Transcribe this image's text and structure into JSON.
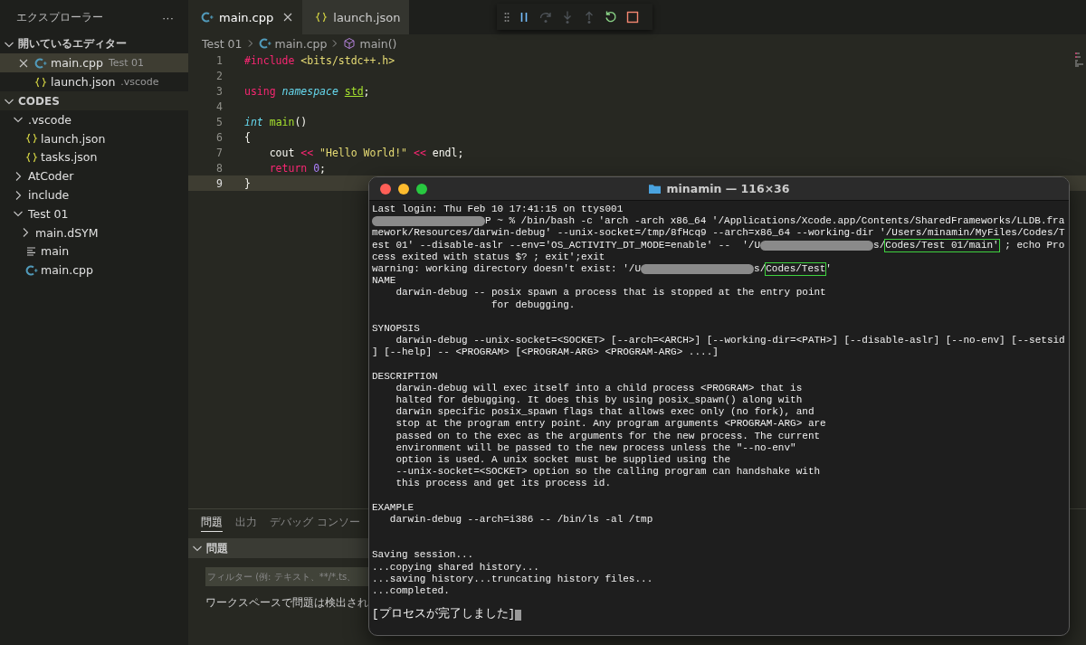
{
  "sidebar": {
    "title": "エクスプローラー",
    "more": "···",
    "open_editors": {
      "title": "開いているエディター",
      "expanded": true,
      "items": [
        {
          "name": "main.cpp",
          "description": "Test 01",
          "kind": "cpp",
          "selected": true
        },
        {
          "name": "launch.json",
          "description": ".vscode",
          "kind": "json",
          "selected": false
        }
      ]
    },
    "folder": {
      "title": "CODES",
      "expanded": true,
      "items": [
        {
          "name": ".vscode",
          "kind": "folder",
          "expanded": true,
          "children": [
            {
              "name": "launch.json",
              "kind": "json"
            },
            {
              "name": "tasks.json",
              "kind": "json"
            }
          ]
        },
        {
          "name": "AtCoder",
          "kind": "folder",
          "expanded": false
        },
        {
          "name": "include",
          "kind": "folder",
          "expanded": false
        },
        {
          "name": "Test 01",
          "kind": "folder",
          "expanded": true,
          "children": [
            {
              "name": "main.dSYM",
              "kind": "folder",
              "expanded": false
            },
            {
              "name": "main",
              "kind": "binary"
            },
            {
              "name": "main.cpp",
              "kind": "cpp"
            }
          ]
        }
      ]
    }
  },
  "tabs": [
    {
      "label": "main.cpp",
      "kind": "cpp",
      "selected": true
    },
    {
      "label": "launch.json",
      "kind": "json",
      "selected": false
    }
  ],
  "debug_toolbar": [
    {
      "kind": "grip",
      "disabled": false
    },
    {
      "kind": "pause",
      "disabled": false
    },
    {
      "kind": "step-over",
      "disabled": true
    },
    {
      "kind": "step-into",
      "disabled": true
    },
    {
      "kind": "step-out",
      "disabled": true
    },
    {
      "kind": "restart",
      "disabled": false
    },
    {
      "kind": "stop",
      "disabled": false
    }
  ],
  "breadcrumb": [
    {
      "label": "Test 01",
      "kind": "folder"
    },
    {
      "label": "main.cpp",
      "kind": "cpp"
    },
    {
      "label": "main()",
      "kind": "symbol"
    }
  ],
  "code": [
    {
      "number": "1",
      "current": false,
      "tokens": [
        {
          "kind": "keyword",
          "text": "#include "
        },
        {
          "kind": "string",
          "text": "<bits/stdc++.h>"
        }
      ]
    },
    {
      "number": "2",
      "current": false
    },
    {
      "number": "3",
      "current": false,
      "tokens": [
        {
          "kind": "keyword",
          "text": "using "
        },
        {
          "kind": "type",
          "text": "namespace "
        },
        {
          "kind": "name",
          "text": "std"
        },
        {
          "kind": "plain",
          "text": ";"
        }
      ]
    },
    {
      "number": "4",
      "current": false
    },
    {
      "number": "5",
      "current": false,
      "tokens": [
        {
          "kind": "type",
          "text": "int "
        },
        {
          "kind": "func",
          "text": "main"
        },
        {
          "kind": "plain",
          "text": "()"
        }
      ]
    },
    {
      "number": "6",
      "current": false,
      "tokens": [
        {
          "kind": "plain",
          "text": "{"
        }
      ]
    },
    {
      "number": "7",
      "current": false,
      "tokens": [
        {
          "kind": "plain",
          "text": "    cout "
        },
        {
          "kind": "keyword",
          "text": "<< "
        },
        {
          "kind": "string",
          "text": "\"Hello World!\" "
        },
        {
          "kind": "keyword",
          "text": "<< "
        },
        {
          "kind": "plain",
          "text": "endl;"
        }
      ]
    },
    {
      "number": "8",
      "current": false,
      "tokens": [
        {
          "kind": "keyword",
          "text": "    return "
        },
        {
          "kind": "number",
          "text": "0"
        },
        {
          "kind": "plain",
          "text": ";"
        }
      ]
    },
    {
      "number": "9",
      "current": true,
      "tokens": [
        {
          "kind": "plain",
          "text": "}"
        }
      ]
    }
  ],
  "panel": {
    "tabs": [
      {
        "label": "問題",
        "selected": true
      },
      {
        "label": "出力",
        "selected": false
      },
      {
        "label": "デバッグ コンソー",
        "selected": false
      }
    ],
    "section": "問題",
    "filter": {
      "placeholder": "フィルター (例: テキスト、**/*.ts、"
    },
    "message": "ワークスペースで問題は検出され"
  },
  "terminal": {
    "title": "minamin — 116×36",
    "lines": [
      {
        "kind": "text",
        "segments": [
          {
            "kind": "text",
            "text": "Last login: Thu Feb 10 17:41:15 on ttys001"
          }
        ]
      },
      {
        "kind": "text",
        "segments": [
          {
            "kind": "redacted"
          },
          {
            "kind": "text",
            "text": "P ~ % /bin/bash -c 'arch -arch x86_64 '/Applications/Xcode.app/Contents/SharedFrameworks/LLDB.fra"
          }
        ]
      },
      {
        "kind": "text",
        "segments": [
          {
            "kind": "text",
            "text": "mework/Resources/darwin-debug' --unix-socket=/tmp/8fHcq9 --arch=x86_64 --working-dir '/Users/minamin/MyFiles/Codes/T"
          }
        ]
      },
      {
        "kind": "text",
        "segments": [
          {
            "kind": "text",
            "text": "est 01' --disable-aslr --env='OS_ACTIVITY_DT_MODE=enable' --  '/U"
          },
          {
            "kind": "redacted"
          },
          {
            "kind": "text",
            "text": "s/"
          },
          {
            "kind": "boxed",
            "text": "Codes/Test 01/main'"
          },
          {
            "kind": "text",
            "text": " ; echo Pro"
          }
        ]
      },
      {
        "kind": "text",
        "segments": [
          {
            "kind": "text",
            "text": "cess exited with status $? ; exit';exit"
          }
        ]
      },
      {
        "kind": "text",
        "segments": [
          {
            "kind": "text",
            "text": "warning: working directory doesn't exist: '/U"
          },
          {
            "kind": "redacted"
          },
          {
            "kind": "text",
            "text": "s/"
          },
          {
            "kind": "boxed",
            "text": "Codes/Test"
          },
          {
            "kind": "text",
            "text": "'"
          }
        ]
      },
      {
        "kind": "text",
        "segments": [
          {
            "kind": "text",
            "text": "NAME"
          }
        ]
      },
      {
        "kind": "text",
        "segments": [
          {
            "kind": "text",
            "text": "    darwin-debug -- posix spawn a process that is stopped at the entry point"
          }
        ]
      },
      {
        "kind": "text",
        "segments": [
          {
            "kind": "text",
            "text": "                    for debugging."
          }
        ]
      },
      {
        "kind": "blank"
      },
      {
        "kind": "text",
        "segments": [
          {
            "kind": "text",
            "text": "SYNOPSIS"
          }
        ]
      },
      {
        "kind": "text",
        "segments": [
          {
            "kind": "text",
            "text": "    darwin-debug --unix-socket=<SOCKET> [--arch=<ARCH>] [--working-dir=<PATH>] [--disable-aslr] [--no-env] [--setsid"
          }
        ]
      },
      {
        "kind": "text",
        "segments": [
          {
            "kind": "text",
            "text": "] [--help] -- <PROGRAM> [<PROGRAM-ARG> <PROGRAM-ARG> ....]"
          }
        ]
      },
      {
        "kind": "blank"
      },
      {
        "kind": "text",
        "segments": [
          {
            "kind": "text",
            "text": "DESCRIPTION"
          }
        ]
      },
      {
        "kind": "text",
        "segments": [
          {
            "kind": "text",
            "text": "    darwin-debug will exec itself into a child process <PROGRAM> that is"
          }
        ]
      },
      {
        "kind": "text",
        "segments": [
          {
            "kind": "text",
            "text": "    halted for debugging. It does this by using posix_spawn() along with"
          }
        ]
      },
      {
        "kind": "text",
        "segments": [
          {
            "kind": "text",
            "text": "    darwin specific posix_spawn flags that allows exec only (no fork), and"
          }
        ]
      },
      {
        "kind": "text",
        "segments": [
          {
            "kind": "text",
            "text": "    stop at the program entry point. Any program arguments <PROGRAM-ARG> are"
          }
        ]
      },
      {
        "kind": "text",
        "segments": [
          {
            "kind": "text",
            "text": "    passed on to the exec as the arguments for the new process. The current"
          }
        ]
      },
      {
        "kind": "text",
        "segments": [
          {
            "kind": "text",
            "text": "    environment will be passed to the new process unless the \"--no-env\""
          }
        ]
      },
      {
        "kind": "text",
        "segments": [
          {
            "kind": "text",
            "text": "    option is used. A unix socket must be supplied using the"
          }
        ]
      },
      {
        "kind": "text",
        "segments": [
          {
            "kind": "text",
            "text": "    --unix-socket=<SOCKET> option so the calling program can handshake with"
          }
        ]
      },
      {
        "kind": "text",
        "segments": [
          {
            "kind": "text",
            "text": "    this process and get its process id."
          }
        ]
      },
      {
        "kind": "blank"
      },
      {
        "kind": "text",
        "segments": [
          {
            "kind": "text",
            "text": "EXAMPLE"
          }
        ]
      },
      {
        "kind": "text",
        "segments": [
          {
            "kind": "text",
            "text": "   darwin-debug --arch=i386 -- /bin/ls -al /tmp"
          }
        ]
      },
      {
        "kind": "blank"
      },
      {
        "kind": "blank"
      },
      {
        "kind": "text",
        "segments": [
          {
            "kind": "text",
            "text": "Saving session..."
          }
        ]
      },
      {
        "kind": "text",
        "segments": [
          {
            "kind": "text",
            "text": "...copying shared history..."
          }
        ]
      },
      {
        "kind": "text",
        "segments": [
          {
            "kind": "text",
            "text": "...saving history...truncating history files..."
          }
        ]
      },
      {
        "kind": "text",
        "segments": [
          {
            "kind": "text",
            "text": "...completed."
          }
        ]
      },
      {
        "kind": "blank"
      },
      {
        "kind": "text",
        "cursor": true,
        "segments": [
          {
            "kind": "text",
            "text": "[プロセスが完了しました]"
          }
        ]
      }
    ]
  }
}
